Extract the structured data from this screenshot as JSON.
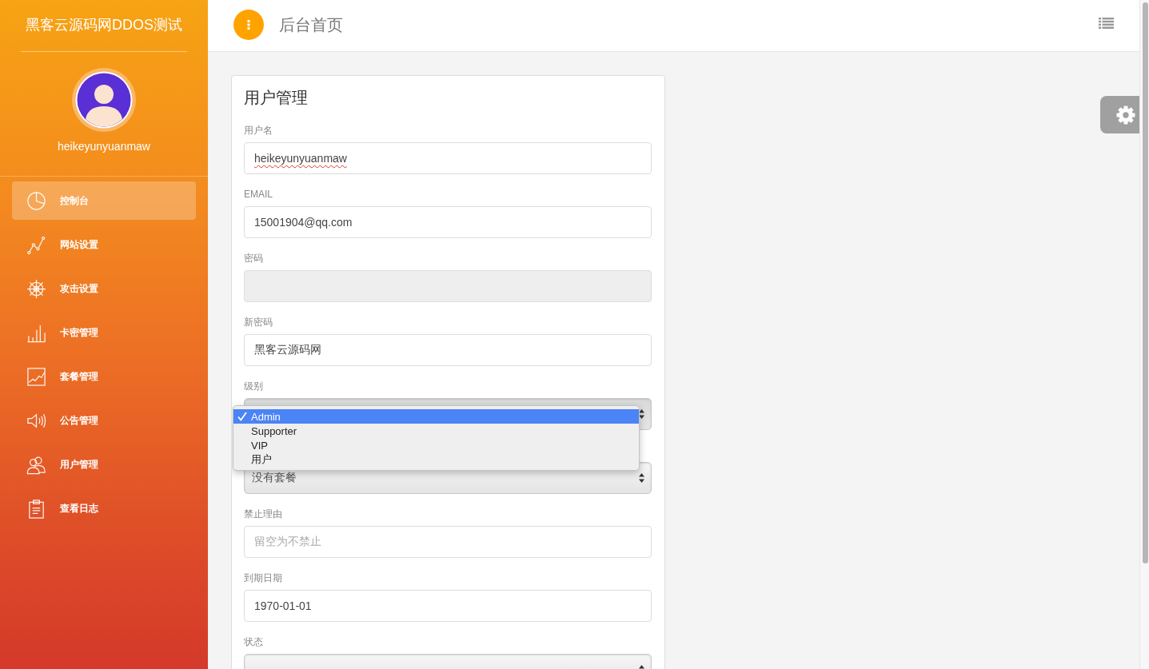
{
  "sidebar": {
    "title": "黑客云源码网DDOS测试",
    "username": "heikeyunyuanmaw",
    "menu": [
      {
        "label": "控制台",
        "selected": true
      },
      {
        "label": "网站设置",
        "selected": false
      },
      {
        "label": "攻击设置",
        "selected": false
      },
      {
        "label": "卡密管理",
        "selected": false
      },
      {
        "label": "套餐管理",
        "selected": false
      },
      {
        "label": "公告管理",
        "selected": false
      },
      {
        "label": "用户管理",
        "selected": false
      },
      {
        "label": "查看日志",
        "selected": false
      }
    ]
  },
  "topbar": {
    "title": "后台首页"
  },
  "card": {
    "title": "用户管理",
    "fields": [
      {
        "kind": "text",
        "label": "用户名",
        "value": "heikeyunyuanmaw",
        "disabled": false,
        "misspelled": true
      },
      {
        "kind": "text",
        "label": "EMAIL",
        "value": "15001904@qq.com",
        "disabled": false,
        "misspelled": false
      },
      {
        "kind": "text",
        "label": "密码",
        "disabled": true
      },
      {
        "kind": "text",
        "label": "新密码",
        "value": "黑客云源码网",
        "disabled": false,
        "misspelled": false
      },
      {
        "kind": "select",
        "label": "级别",
        "expanded": true,
        "options": [
          {
            "label": "Admin",
            "selected": true
          },
          {
            "label": "Supporter",
            "selected": false
          },
          {
            "label": "VIP",
            "selected": false
          },
          {
            "label": "用户",
            "selected": false
          }
        ]
      },
      {
        "kind": "select",
        "value": "没有套餐",
        "expanded": false
      },
      {
        "kind": "text",
        "label": "禁止理由",
        "placeholder": "留空为不禁止",
        "disabled": false
      },
      {
        "kind": "text",
        "label": "到期日期",
        "value": "1970-01-01",
        "disabled": false,
        "misspelled": false
      },
      {
        "kind": "select",
        "label": "状态",
        "expanded": false
      }
    ]
  }
}
